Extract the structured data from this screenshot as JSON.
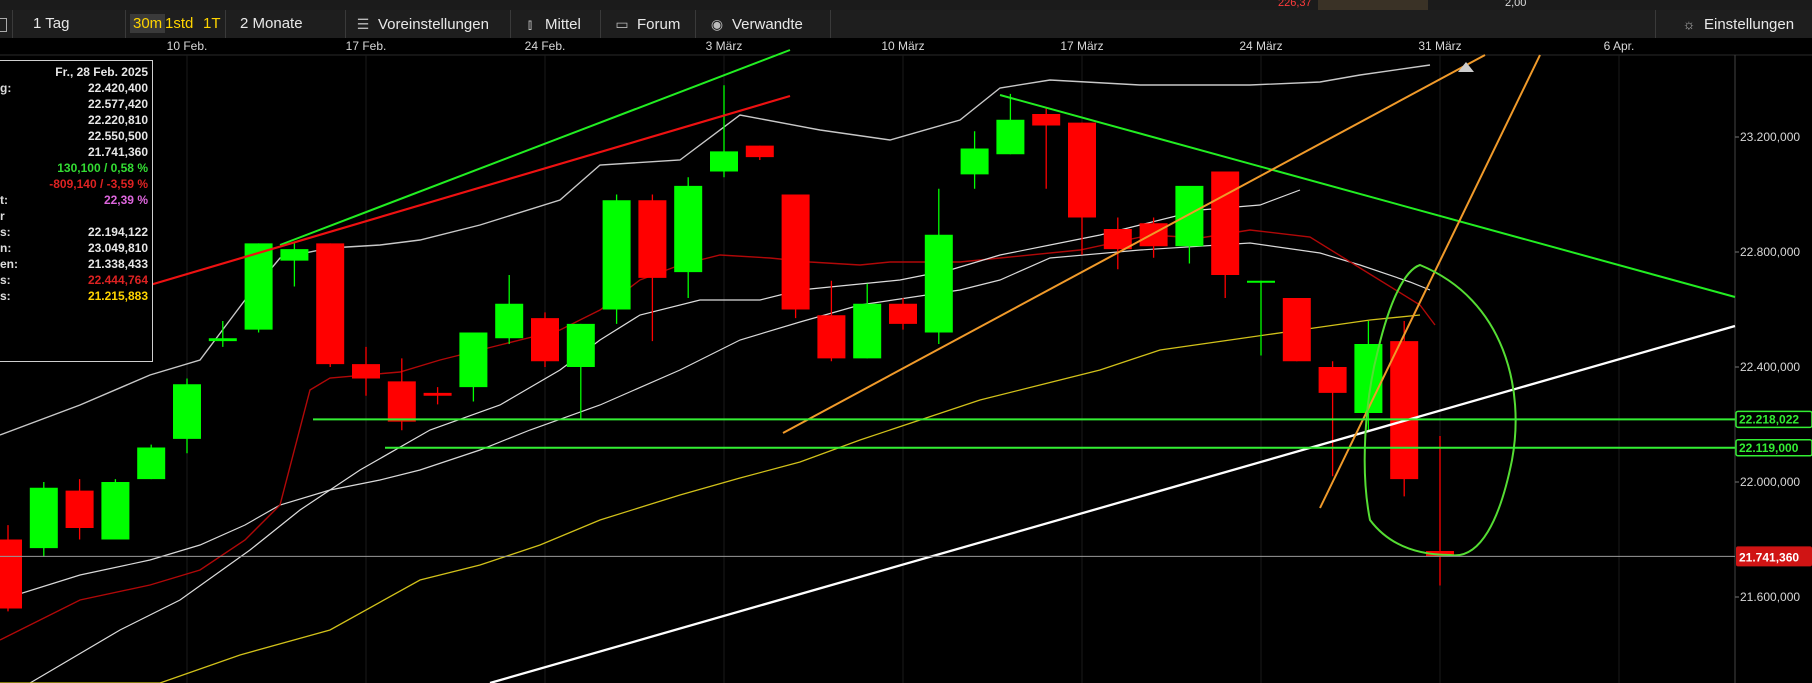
{
  "top_strip": {
    "value_1": "226,37",
    "value_2": "2,00"
  },
  "toolbar": {
    "interval_icon": "grid-icon",
    "interval": "1 Tag",
    "res_30m": "30m",
    "res_1std": "1std",
    "res_1t": "1T",
    "range": "2 Monate",
    "presets": "Voreinstellungen",
    "averages": "Mittel",
    "forum": "Forum",
    "related": "Verwandte",
    "settings": "Einstellungen"
  },
  "infobox": {
    "rows": [
      {
        "label": "",
        "value": "Fr., 28 Feb. 2025",
        "color": "#e6e6e6"
      },
      {
        "label": "g:",
        "value": "22.420,400",
        "color": "#e6e6e6"
      },
      {
        "label": "",
        "value": "22.577,420",
        "color": "#e6e6e6"
      },
      {
        "label": "",
        "value": "22.220,810",
        "color": "#e6e6e6"
      },
      {
        "label": "",
        "value": "22.550,500",
        "color": "#e6e6e6"
      },
      {
        "label": "",
        "value": "21.741,360",
        "color": "#e6e6e6"
      },
      {
        "label": "",
        "value": "130,100 / 0,58 %",
        "color": "#33dd33"
      },
      {
        "label": "",
        "value": "-809,140 / -3,59 %",
        "color": "#dd2222"
      },
      {
        "label": "t:",
        "value": "22,39 %",
        "color": "#dd66dd"
      },
      {
        "label": "r",
        "value": "",
        "color": "#e6e6e6"
      },
      {
        "label": "s:",
        "value": "22.194,122",
        "color": "#e6e6e6"
      },
      {
        "label": "n:",
        "value": "23.049,810",
        "color": "#e6e6e6"
      },
      {
        "label": "en:",
        "value": "21.338,433",
        "color": "#e6e6e6"
      },
      {
        "label": "s:",
        "value": "22.444,764",
        "color": "#dd2222"
      },
      {
        "label": "s:",
        "value": "21.215,883",
        "color": "#ffd400"
      }
    ]
  },
  "chart_data": {
    "type": "candlestick",
    "price_range": [
      21400,
      23500
    ],
    "price_ticks": [
      21600,
      22000,
      22400,
      22800,
      23200
    ],
    "price_tick_labels": [
      "21.600,000",
      "22.000,000",
      "22.400,000",
      "22.800,000",
      "23.200,000"
    ],
    "date_labels": [
      {
        "label": "10 Feb.",
        "index": 5
      },
      {
        "label": "17 Feb.",
        "index": 10
      },
      {
        "label": "24 Feb.",
        "index": 15
      },
      {
        "label": "3 März",
        "index": 20
      },
      {
        "label": "10 März",
        "index": 25
      },
      {
        "label": "17 März",
        "index": 30
      },
      {
        "label": "24 März",
        "index": 35
      },
      {
        "label": "31 März",
        "index": 40
      },
      {
        "label": "6 Apr.",
        "index": 45
      }
    ],
    "candles": [
      {
        "o": 21800,
        "h": 21850,
        "l": 21550,
        "c": 21560
      },
      {
        "o": 21770,
        "h": 22000,
        "l": 21740,
        "c": 21980
      },
      {
        "o": 21970,
        "h": 22010,
        "l": 21800,
        "c": 21840
      },
      {
        "o": 21800,
        "h": 22010,
        "l": 21800,
        "c": 22000
      },
      {
        "o": 22010,
        "h": 22130,
        "l": 22010,
        "c": 22120
      },
      {
        "o": 22150,
        "h": 22360,
        "l": 22100,
        "c": 22340
      },
      {
        "o": 22490,
        "h": 22560,
        "l": 22470,
        "c": 22500
      },
      {
        "o": 22530,
        "h": 22830,
        "l": 22520,
        "c": 22830
      },
      {
        "o": 22770,
        "h": 22830,
        "l": 22680,
        "c": 22810
      },
      {
        "o": 22830,
        "h": 22830,
        "l": 22400,
        "c": 22410
      },
      {
        "o": 22410,
        "h": 22470,
        "l": 22300,
        "c": 22360
      },
      {
        "o": 22350,
        "h": 22430,
        "l": 22180,
        "c": 22210
      },
      {
        "o": 22310,
        "h": 22330,
        "l": 22270,
        "c": 22300
      },
      {
        "o": 22330,
        "h": 22520,
        "l": 22280,
        "c": 22520
      },
      {
        "o": 22500,
        "h": 22720,
        "l": 22480,
        "c": 22620
      },
      {
        "o": 22570,
        "h": 22590,
        "l": 22400,
        "c": 22420
      },
      {
        "o": 22400,
        "h": 22550,
        "l": 22220,
        "c": 22550
      },
      {
        "o": 22600,
        "h": 23000,
        "l": 22550,
        "c": 22980
      },
      {
        "o": 22980,
        "h": 23000,
        "l": 22490,
        "c": 22710
      },
      {
        "o": 22730,
        "h": 23060,
        "l": 22640,
        "c": 23030
      },
      {
        "o": 23080,
        "h": 23380,
        "l": 23060,
        "c": 23150
      },
      {
        "o": 23170,
        "h": 23170,
        "l": 23120,
        "c": 23130
      },
      {
        "o": 23000,
        "h": 23000,
        "l": 22570,
        "c": 22600
      },
      {
        "o": 22580,
        "h": 22700,
        "l": 22420,
        "c": 22430
      },
      {
        "o": 22430,
        "h": 22690,
        "l": 22430,
        "c": 22620
      },
      {
        "o": 22620,
        "h": 22640,
        "l": 22530,
        "c": 22550
      },
      {
        "o": 22520,
        "h": 23020,
        "l": 22480,
        "c": 22860
      },
      {
        "o": 23070,
        "h": 23220,
        "l": 23020,
        "c": 23160
      },
      {
        "o": 23140,
        "h": 23350,
        "l": 23140,
        "c": 23260
      },
      {
        "o": 23280,
        "h": 23300,
        "l": 23020,
        "c": 23240
      },
      {
        "o": 23250,
        "h": 23250,
        "l": 22790,
        "c": 22920
      },
      {
        "o": 22880,
        "h": 22920,
        "l": 22740,
        "c": 22810
      },
      {
        "o": 22900,
        "h": 22920,
        "l": 22780,
        "c": 22820
      },
      {
        "o": 22820,
        "h": 23010,
        "l": 22760,
        "c": 23030
      },
      {
        "o": 23080,
        "h": 23000,
        "l": 22640,
        "c": 22720
      },
      {
        "o": 22700,
        "h": 22700,
        "l": 22440,
        "c": 22700
      },
      {
        "o": 22640,
        "h": 22640,
        "l": 22420,
        "c": 22420
      },
      {
        "o": 22400,
        "h": 22420,
        "l": 22020,
        "c": 22310
      },
      {
        "o": 22240,
        "h": 22560,
        "l": 22180,
        "c": 22480
      },
      {
        "o": 22490,
        "h": 22560,
        "l": 21950,
        "c": 22010
      },
      {
        "o": 21760,
        "h": 22160,
        "l": 21640,
        "c": 21741.36
      }
    ],
    "horizontal_lines": [
      {
        "value": 22218.022,
        "label": "22.218,022",
        "color": "#33ee33"
      },
      {
        "value": 22119.0,
        "label": "22.119,000",
        "color": "#33ee33"
      }
    ],
    "current_price": {
      "value": 21741.36,
      "label": "21.741,360",
      "color": "#d01414"
    },
    "colors": {
      "up": "#00ff00",
      "down": "#ff0000",
      "bg": "#000000",
      "grid": "#1a1a1a"
    }
  }
}
